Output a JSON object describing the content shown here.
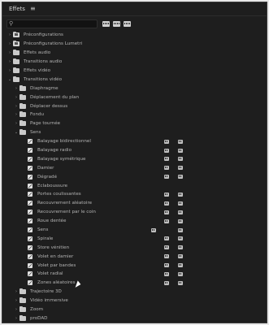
{
  "panel": {
    "title": "Effets",
    "menu_glyph": "≡"
  },
  "search": {
    "icon": "search-icon",
    "placeholder": ""
  },
  "filters": [
    "accelerated-effects-icon",
    "32bit-color-icon",
    "yuv-effects-icon"
  ],
  "tree": [
    {
      "label": "Préconfigurations",
      "level": 0,
      "expanded": false,
      "icon": "preset-folder-icon"
    },
    {
      "label": "Préconfigurations Lumetri",
      "level": 0,
      "expanded": false,
      "icon": "preset-folder-icon"
    },
    {
      "label": "Effets audio",
      "level": 0,
      "expanded": false,
      "icon": "folder-icon"
    },
    {
      "label": "Transitions audio",
      "level": 0,
      "expanded": false,
      "icon": "folder-icon"
    },
    {
      "label": "Effets vidéo",
      "level": 0,
      "expanded": false,
      "icon": "folder-icon"
    },
    {
      "label": "Transitions vidéo",
      "level": 0,
      "expanded": true,
      "icon": "folder-icon"
    },
    {
      "label": "Diaphragme",
      "level": 1,
      "expanded": false,
      "icon": "folder-icon"
    },
    {
      "label": "Déplacement du plan",
      "level": 1,
      "expanded": false,
      "icon": "folder-icon"
    },
    {
      "label": "Déplacer dessus",
      "level": 1,
      "expanded": false,
      "icon": "folder-icon"
    },
    {
      "label": "Fondu",
      "level": 1,
      "expanded": false,
      "icon": "folder-icon"
    },
    {
      "label": "Page tournée",
      "level": 1,
      "expanded": false,
      "icon": "folder-icon"
    },
    {
      "label": "Sens",
      "level": 1,
      "expanded": true,
      "icon": "folder-icon"
    },
    {
      "label": "Balayage bidirectionnel",
      "level": 2,
      "badges": [
        1,
        2
      ]
    },
    {
      "label": "Balayage radio",
      "level": 2,
      "badges": [
        1,
        2
      ]
    },
    {
      "label": "Balayage symétrique",
      "level": 2,
      "badges": [
        1,
        2
      ]
    },
    {
      "label": "Damier",
      "level": 2,
      "badges": [
        1,
        2
      ]
    },
    {
      "label": "Dégradé",
      "level": 2,
      "badges": [
        1,
        2
      ]
    },
    {
      "label": "Eclaboussure",
      "level": 2,
      "badges": []
    },
    {
      "label": "Portes coulissantes",
      "level": 2,
      "badges": [
        1,
        2
      ]
    },
    {
      "label": "Recouvrement aléatoire",
      "level": 2,
      "badges": [
        1,
        2
      ]
    },
    {
      "label": "Recouvrement par le coin",
      "level": 2,
      "badges": [
        1,
        2
      ]
    },
    {
      "label": "Roue dentée",
      "level": 2,
      "badges": [
        1,
        2
      ]
    },
    {
      "label": "Sens",
      "level": 2,
      "badges": [
        3,
        2
      ]
    },
    {
      "label": "Spirale",
      "level": 2,
      "badges": [
        1,
        2
      ]
    },
    {
      "label": "Store vénitien",
      "level": 2,
      "badges": [
        1,
        2
      ]
    },
    {
      "label": "Volet en damier",
      "level": 2,
      "badges": [
        1,
        2
      ]
    },
    {
      "label": "Volet par bandes",
      "level": 2,
      "badges": [
        1,
        2
      ]
    },
    {
      "label": "Volet radial",
      "level": 2,
      "badges": [
        1,
        2
      ]
    },
    {
      "label": "Zones aléatoires",
      "level": 2,
      "badges": [
        1,
        2
      ]
    },
    {
      "label": "Trajectoire 3D",
      "level": 1,
      "expanded": false,
      "icon": "folder-icon"
    },
    {
      "label": "Vidéo immersive",
      "level": 1,
      "expanded": false,
      "icon": "folder-icon"
    },
    {
      "label": "Zoom",
      "level": 1,
      "expanded": false,
      "icon": "folder-icon"
    },
    {
      "label": "proDAD",
      "level": 1,
      "expanded": false,
      "icon": "folder-icon"
    }
  ]
}
